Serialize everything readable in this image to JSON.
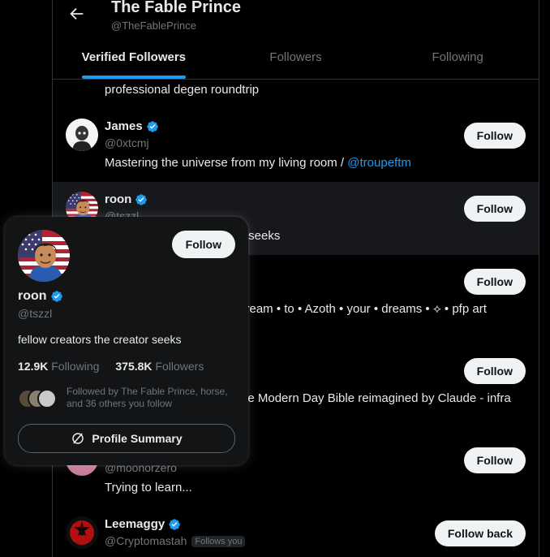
{
  "header": {
    "title": "The Fable Prince",
    "handle": "@TheFablePrince"
  },
  "tabs": [
    {
      "label": "Verified Followers",
      "active": true
    },
    {
      "label": "Followers",
      "active": false
    },
    {
      "label": "Following",
      "active": false
    }
  ],
  "list": {
    "top_bio": "professional degen roundtrip",
    "rows": [
      {
        "name": "James",
        "handle": "@0xtcmj",
        "bio": "Mastering the universe from my living room / ",
        "bio_link": "@troupeftm",
        "button": "Follow"
      },
      {
        "name": "roon",
        "handle": "@tszzl",
        "bio_visible": "r seeks",
        "button": "Follow"
      },
      {
        "bio_visible": "cream • to • Azoth • your • dreams • ⟡ • pfp art",
        "button": "Follow"
      },
      {
        "bio_visible": "he Modern Day Bible reimagined by Claude - infra",
        "button": "Follow"
      },
      {
        "handle": "@moonorzero",
        "bio": "Trying to learn...",
        "button": "Follow"
      },
      {
        "name": "Leemaggy",
        "handle": "@Cryptomastah",
        "follows_you": "Follows you",
        "button": "Follow back"
      }
    ]
  },
  "hovercard": {
    "name": "roon",
    "handle": "@tszzl",
    "bio": "fellow creators the creator seeks",
    "following_count": "12.9K",
    "following_label": "Following",
    "followers_count": "375.8K",
    "followers_label": "Followers",
    "mutuals_text": "Followed by The Fable Prince, horse, and 36 others you follow",
    "follow_button": "Follow",
    "summary_button": "Profile Summary"
  },
  "colors": {
    "accent": "#1d9bf0",
    "background": "#000000",
    "card": "#121416",
    "muted": "#71767b"
  },
  "icons": {
    "back": "arrow-left-icon",
    "verified": "verified-badge-icon",
    "summary": "grok-icon"
  }
}
